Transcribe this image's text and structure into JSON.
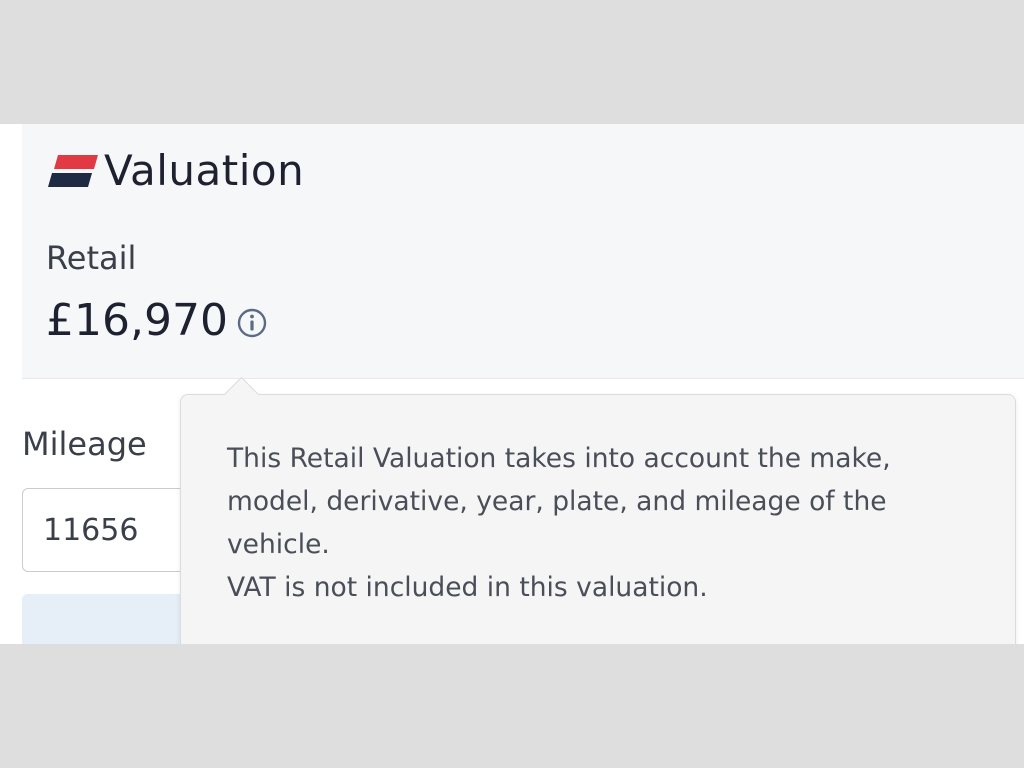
{
  "brand": {
    "title": "Valuation",
    "logo_colors": [
      "#e23a44",
      "#1f2a44"
    ]
  },
  "valuation": {
    "label": "Retail",
    "price": "£16,970",
    "info_icon": "info-circle-icon"
  },
  "mileage": {
    "label": "Mileage",
    "value": "11656"
  },
  "tooltip": {
    "line1": "This Retail Valuation takes into account the make, model, derivative, year, plate, and mileage of the vehicle.",
    "line2": "VAT is not included in this valuation."
  },
  "colors": {
    "accent_red": "#e23a44",
    "navy": "#1f2a44",
    "card_bg": "#f6f7f9",
    "tooltip_bg": "#f5f5f5",
    "button_bg": "#e6eef8"
  }
}
